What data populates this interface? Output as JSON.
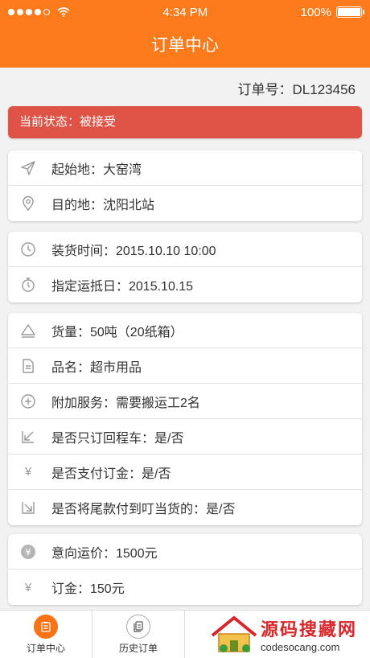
{
  "status_bar": {
    "time": "4:34 PM",
    "battery": "100%"
  },
  "header": {
    "title": "订单中心"
  },
  "order": {
    "number": "订单号：DL123456"
  },
  "state": {
    "text": "当前状态：被接受"
  },
  "route": {
    "origin": "起始地：大窑湾",
    "destination": "目的地：沈阳北站"
  },
  "timing": {
    "load_time": "装货时间：2015.10.10  10:00",
    "arrival_date": "指定运抵日：2015.10.15"
  },
  "cargo": {
    "quantity": "货量：50吨（20纸箱）",
    "goods_name": "品名：超市用品",
    "extra_service": "附加服务：需要搬运工2名",
    "return_trip": "是否只订回程车：是/否",
    "deposit_paid": "是否支付订金：是/否",
    "final_payment": "是否将尾款付到叮当货的：是/否"
  },
  "price": {
    "freight": "意向运价：1500元",
    "deposit": "订金：150元"
  },
  "tabs": [
    {
      "label": "订单中心",
      "active": true
    },
    {
      "label": "历史订单",
      "active": false
    }
  ],
  "watermark": {
    "title": "源码搜藏网",
    "url": "codesocang.com"
  },
  "colors": {
    "accent": "#fa7a1c",
    "state_bg": "#de5346"
  }
}
